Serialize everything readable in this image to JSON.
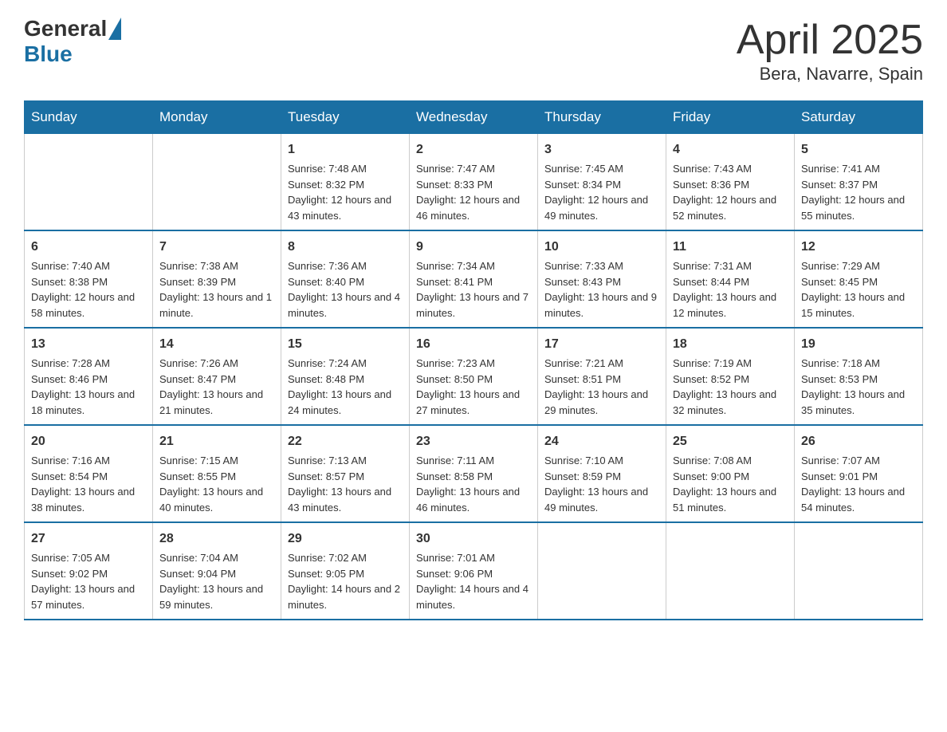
{
  "header": {
    "logo_general": "General",
    "logo_blue": "Blue",
    "month": "April 2025",
    "location": "Bera, Navarre, Spain"
  },
  "weekdays": [
    "Sunday",
    "Monday",
    "Tuesday",
    "Wednesday",
    "Thursday",
    "Friday",
    "Saturday"
  ],
  "weeks": [
    [
      {
        "day": "",
        "sunrise": "",
        "sunset": "",
        "daylight": ""
      },
      {
        "day": "",
        "sunrise": "",
        "sunset": "",
        "daylight": ""
      },
      {
        "day": "1",
        "sunrise": "Sunrise: 7:48 AM",
        "sunset": "Sunset: 8:32 PM",
        "daylight": "Daylight: 12 hours and 43 minutes."
      },
      {
        "day": "2",
        "sunrise": "Sunrise: 7:47 AM",
        "sunset": "Sunset: 8:33 PM",
        "daylight": "Daylight: 12 hours and 46 minutes."
      },
      {
        "day": "3",
        "sunrise": "Sunrise: 7:45 AM",
        "sunset": "Sunset: 8:34 PM",
        "daylight": "Daylight: 12 hours and 49 minutes."
      },
      {
        "day": "4",
        "sunrise": "Sunrise: 7:43 AM",
        "sunset": "Sunset: 8:36 PM",
        "daylight": "Daylight: 12 hours and 52 minutes."
      },
      {
        "day": "5",
        "sunrise": "Sunrise: 7:41 AM",
        "sunset": "Sunset: 8:37 PM",
        "daylight": "Daylight: 12 hours and 55 minutes."
      }
    ],
    [
      {
        "day": "6",
        "sunrise": "Sunrise: 7:40 AM",
        "sunset": "Sunset: 8:38 PM",
        "daylight": "Daylight: 12 hours and 58 minutes."
      },
      {
        "day": "7",
        "sunrise": "Sunrise: 7:38 AM",
        "sunset": "Sunset: 8:39 PM",
        "daylight": "Daylight: 13 hours and 1 minute."
      },
      {
        "day": "8",
        "sunrise": "Sunrise: 7:36 AM",
        "sunset": "Sunset: 8:40 PM",
        "daylight": "Daylight: 13 hours and 4 minutes."
      },
      {
        "day": "9",
        "sunrise": "Sunrise: 7:34 AM",
        "sunset": "Sunset: 8:41 PM",
        "daylight": "Daylight: 13 hours and 7 minutes."
      },
      {
        "day": "10",
        "sunrise": "Sunrise: 7:33 AM",
        "sunset": "Sunset: 8:43 PM",
        "daylight": "Daylight: 13 hours and 9 minutes."
      },
      {
        "day": "11",
        "sunrise": "Sunrise: 7:31 AM",
        "sunset": "Sunset: 8:44 PM",
        "daylight": "Daylight: 13 hours and 12 minutes."
      },
      {
        "day": "12",
        "sunrise": "Sunrise: 7:29 AM",
        "sunset": "Sunset: 8:45 PM",
        "daylight": "Daylight: 13 hours and 15 minutes."
      }
    ],
    [
      {
        "day": "13",
        "sunrise": "Sunrise: 7:28 AM",
        "sunset": "Sunset: 8:46 PM",
        "daylight": "Daylight: 13 hours and 18 minutes."
      },
      {
        "day": "14",
        "sunrise": "Sunrise: 7:26 AM",
        "sunset": "Sunset: 8:47 PM",
        "daylight": "Daylight: 13 hours and 21 minutes."
      },
      {
        "day": "15",
        "sunrise": "Sunrise: 7:24 AM",
        "sunset": "Sunset: 8:48 PM",
        "daylight": "Daylight: 13 hours and 24 minutes."
      },
      {
        "day": "16",
        "sunrise": "Sunrise: 7:23 AM",
        "sunset": "Sunset: 8:50 PM",
        "daylight": "Daylight: 13 hours and 27 minutes."
      },
      {
        "day": "17",
        "sunrise": "Sunrise: 7:21 AM",
        "sunset": "Sunset: 8:51 PM",
        "daylight": "Daylight: 13 hours and 29 minutes."
      },
      {
        "day": "18",
        "sunrise": "Sunrise: 7:19 AM",
        "sunset": "Sunset: 8:52 PM",
        "daylight": "Daylight: 13 hours and 32 minutes."
      },
      {
        "day": "19",
        "sunrise": "Sunrise: 7:18 AM",
        "sunset": "Sunset: 8:53 PM",
        "daylight": "Daylight: 13 hours and 35 minutes."
      }
    ],
    [
      {
        "day": "20",
        "sunrise": "Sunrise: 7:16 AM",
        "sunset": "Sunset: 8:54 PM",
        "daylight": "Daylight: 13 hours and 38 minutes."
      },
      {
        "day": "21",
        "sunrise": "Sunrise: 7:15 AM",
        "sunset": "Sunset: 8:55 PM",
        "daylight": "Daylight: 13 hours and 40 minutes."
      },
      {
        "day": "22",
        "sunrise": "Sunrise: 7:13 AM",
        "sunset": "Sunset: 8:57 PM",
        "daylight": "Daylight: 13 hours and 43 minutes."
      },
      {
        "day": "23",
        "sunrise": "Sunrise: 7:11 AM",
        "sunset": "Sunset: 8:58 PM",
        "daylight": "Daylight: 13 hours and 46 minutes."
      },
      {
        "day": "24",
        "sunrise": "Sunrise: 7:10 AM",
        "sunset": "Sunset: 8:59 PM",
        "daylight": "Daylight: 13 hours and 49 minutes."
      },
      {
        "day": "25",
        "sunrise": "Sunrise: 7:08 AM",
        "sunset": "Sunset: 9:00 PM",
        "daylight": "Daylight: 13 hours and 51 minutes."
      },
      {
        "day": "26",
        "sunrise": "Sunrise: 7:07 AM",
        "sunset": "Sunset: 9:01 PM",
        "daylight": "Daylight: 13 hours and 54 minutes."
      }
    ],
    [
      {
        "day": "27",
        "sunrise": "Sunrise: 7:05 AM",
        "sunset": "Sunset: 9:02 PM",
        "daylight": "Daylight: 13 hours and 57 minutes."
      },
      {
        "day": "28",
        "sunrise": "Sunrise: 7:04 AM",
        "sunset": "Sunset: 9:04 PM",
        "daylight": "Daylight: 13 hours and 59 minutes."
      },
      {
        "day": "29",
        "sunrise": "Sunrise: 7:02 AM",
        "sunset": "Sunset: 9:05 PM",
        "daylight": "Daylight: 14 hours and 2 minutes."
      },
      {
        "day": "30",
        "sunrise": "Sunrise: 7:01 AM",
        "sunset": "Sunset: 9:06 PM",
        "daylight": "Daylight: 14 hours and 4 minutes."
      },
      {
        "day": "",
        "sunrise": "",
        "sunset": "",
        "daylight": ""
      },
      {
        "day": "",
        "sunrise": "",
        "sunset": "",
        "daylight": ""
      },
      {
        "day": "",
        "sunrise": "",
        "sunset": "",
        "daylight": ""
      }
    ]
  ]
}
